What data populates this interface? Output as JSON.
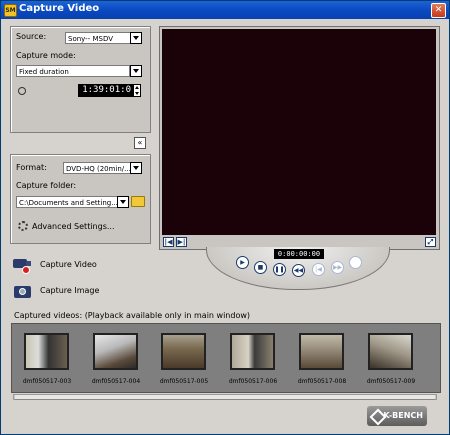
{
  "window": {
    "title": "Capture Video",
    "app_icon": "SM",
    "close_glyph": "✕"
  },
  "settings": {
    "source_label": "Source:",
    "source_value": "Sony-- MSDV",
    "mode_label": "Capture mode:",
    "mode_value": "Fixed duration",
    "duration": "1:39:01:0",
    "format_label": "Format:",
    "format_value": "DVD-HQ (20min/...",
    "folder_label": "Capture folder:",
    "folder_value": "C:\\Documents and Setting...",
    "advanced_label": "Advanced Settings...",
    "collapse_glyph": "«"
  },
  "preview": {
    "timecode": "0:00:00:00 ↕",
    "left_glyph": "|◀",
    "right_glyph": "▶|",
    "expand_glyph": "⤢"
  },
  "transport": [
    "▶",
    "■",
    "❚❚",
    "◀◀",
    "|◀",
    "▶▶"
  ],
  "actions": {
    "capture_video": "Capture Video",
    "capture_image": "Capture Image"
  },
  "captured_label": "Captured videos: (Playback available only in main window)",
  "thumbnails": [
    {
      "name": "dmf050517-003"
    },
    {
      "name": "dmf050517-004"
    },
    {
      "name": "dmf050517-005"
    },
    {
      "name": "dmf050517-006"
    },
    {
      "name": "dmf050517-008"
    },
    {
      "name": "dmf050517-009"
    }
  ],
  "brand": "K-BENCH",
  "colors": {
    "titlebar": "#0a4ac2",
    "preview": "#1a0208",
    "panel": "#c9c6c1",
    "record": "#d62020"
  }
}
